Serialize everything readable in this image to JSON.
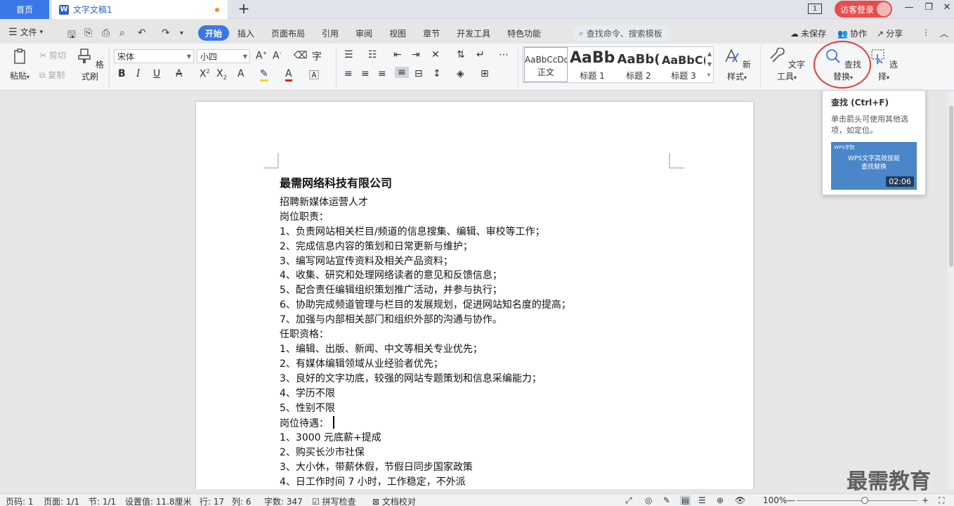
{
  "titlebar": {
    "home_tab": "首页",
    "doc_tab": "文字文稿1",
    "new_tab": "+",
    "page_badge": "1",
    "login_label": "访客登录",
    "min": "—",
    "restore": "❐",
    "close": "✕"
  },
  "menubar": {
    "file_label": "文件",
    "tabs": [
      "开始",
      "插入",
      "页面布局",
      "引用",
      "审阅",
      "视图",
      "章节",
      "开发工具",
      "特色功能"
    ],
    "search_placeholder": "查找命令、搜索模板",
    "unsaved": "未保存",
    "collab": "协作",
    "share": "分享"
  },
  "ribbon": {
    "paste": "粘贴",
    "cut": "剪切",
    "copy": "复制",
    "format_painter": "格式刷",
    "font_name": "宋体",
    "font_size": "小四",
    "styles": [
      {
        "sample": "AaBbCcDd",
        "name": "正文"
      },
      {
        "sample": "AaBb",
        "name": "标题 1"
      },
      {
        "sample": "AaBb(",
        "name": "标题 2"
      },
      {
        "sample": "AaBbC(",
        "name": "标题 3"
      }
    ],
    "new_style": "新样式",
    "text_tools": "文字工具",
    "find_replace": "查找替换",
    "select": "选择"
  },
  "tooltip": {
    "title": "查找 (Ctrl+F)",
    "desc": "单击箭头可使用其他选项，如定位。",
    "video_brand": "WPS学院",
    "video_title_1": "WPS文字高效技能",
    "video_title_2": "查找替换",
    "video_duration": "02:06"
  },
  "document": {
    "title": "最需网络科技有限公司",
    "lines": [
      "招聘新媒体运营人才",
      "岗位职责：",
      "1、负责网站相关栏目/频道的信息搜集、编辑、审校等工作；",
      "2、完成信息内容的策划和日常更新与维护；",
      "3、编写网站宣传资料及相关产品资料；",
      "4、收集、研究和处理网络读者的意见和反馈信息；",
      "5、配合责任编辑组织策划推广活动，并参与执行；",
      "6、协助完成频道管理与栏目的发展规划，促进网站知名度的提高；",
      "7、加强与内部相关部门和组织外部的沟通与协作。",
      "任职资格：",
      "1、编辑、出版、新闻、中文等相关专业优先；",
      "2、有媒体编辑领域从业经验者优先；",
      "3、良好的文字功底，较强的网站专题策划和信息采编能力；",
      "4、学历不限",
      "5、性别不限",
      "岗位待遇：",
      "1、3000 元底薪+提成",
      "2、购买长沙市社保",
      "3、大小休，带薪休假，节假日同步国家政策",
      "4、日工作时间 7 小时，工作稳定，不外派"
    ]
  },
  "statusbar": {
    "page_num": "页码: 1",
    "pages": "页面: 1/1",
    "section": "节: 1/1",
    "setting": "设置值: 11.8厘米",
    "row": "行: 17",
    "col": "列: 6",
    "wordcount": "字数: 347",
    "spellcheck": "拼写检查",
    "proofread": "文档校对",
    "zoom": "100%",
    "zoom_minus": "—",
    "zoom_plus": "+"
  },
  "watermark": "最需教育",
  "colors": {
    "accent": "#3b78e7",
    "login_bg": "#e84d4d",
    "highlight_circle": "#e8383d"
  }
}
